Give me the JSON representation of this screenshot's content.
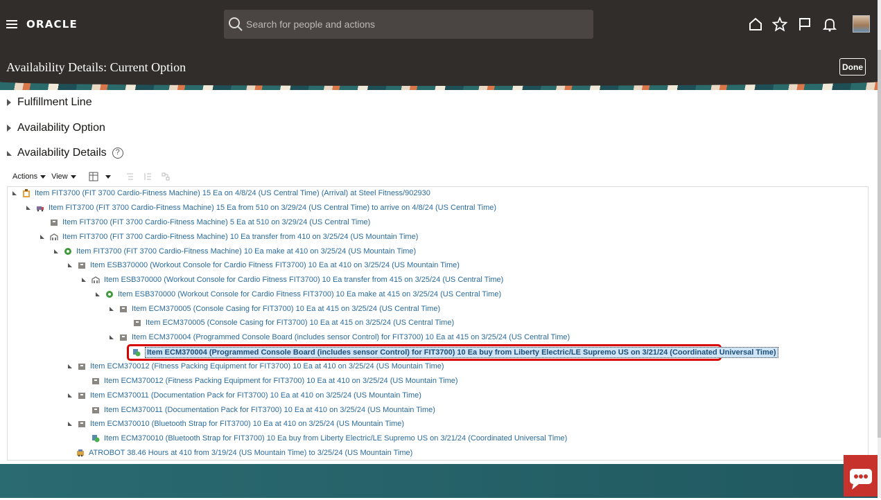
{
  "app": {
    "logo": "ORACLE"
  },
  "search": {
    "placeholder": "Search for people and actions"
  },
  "header": {
    "title": "Availability Details: Current Option",
    "done_label": "Done"
  },
  "sections": {
    "fulfillment": "Fulfillment Line",
    "option": "Availability Option",
    "details": "Availability Details",
    "help_glyph": "?"
  },
  "toolbar": {
    "actions": "Actions",
    "view": "View"
  },
  "tree": [
    {
      "label": "Item FIT3700 (FIT 3700 Cardio-Fitness Machine) 15 Ea on 4/8/24 (US Central Time) (Arrival) at Steel Fitness/902930",
      "icon": "clipboard-icon"
    },
    {
      "label": "Item FIT3700 (FIT 3700 Cardio-Fitness Machine) 15 Ea from 510 on 3/29/24 (US Central Time) to arrive on 4/8/24 (US Central Time)",
      "icon": "shipment-icon"
    },
    {
      "label": "Item FIT3700 (FIT 3700 Cardio-Fitness Machine) 5 Ea at 510 on 3/29/24 (US Central Time)",
      "icon": "inventory-icon"
    },
    {
      "label": "Item FIT3700 (FIT 3700 Cardio-Fitness Machine) 10 Ea transfer from 410 on 3/25/24 (US Mountain Time)",
      "icon": "transfer-icon"
    },
    {
      "label": "Item FIT3700 (FIT 3700 Cardio-Fitness Machine) 10 Ea make at 410 on 3/25/24 (US Mountain Time)",
      "icon": "make-gear-icon"
    },
    {
      "label": "Item ESB370000 (Workout Console for Cardio Fitness FIT3700) 10 Ea at 410 on 3/25/24 (US Mountain Time)",
      "icon": "inventory-icon"
    },
    {
      "label": "Item ESB370000 (Workout Console for Cardio Fitness FIT3700) 10 Ea transfer from 415 on 3/25/24 (US Central Time)",
      "icon": "transfer-icon"
    },
    {
      "label": "Item ESB370000 (Workout Console for Cardio Fitness FIT3700) 10 Ea make at 415 on 3/25/24 (US Central Time)",
      "icon": "make-gear-icon"
    },
    {
      "label": "Item ECM370005 (Console Casing for FIT3700) 10 Ea at 415 on 3/25/24 (US Central Time)",
      "icon": "inventory-icon"
    },
    {
      "label": "Item ECM370005 (Console Casing for FIT3700) 10 Ea at 415 on 3/25/24 (US Central Time)",
      "icon": "inventory-icon"
    },
    {
      "label": "Item ECM370004 (Programmed Console Board (includes sensor Control) for FIT3700) 10 Ea at 415 on 3/25/24 (US Central Time)",
      "icon": "inventory-icon"
    },
    {
      "label": "Item ECM370004 (Programmed Console Board (includes sensor Control) for FIT3700) 10 Ea buy from Liberty Electric/LE Supremo US on 3/21/24 (Coordinated Universal Time)",
      "icon": "buy-icon"
    },
    {
      "label": "Item ECM370012 (Fitness Packing Equipment for FIT3700) 10 Ea at 410 on 3/25/24 (US Mountain Time)",
      "icon": "inventory-icon"
    },
    {
      "label": "Item ECM370012 (Fitness Packing Equipment for FIT3700) 10 Ea at 410 on 3/25/24 (US Mountain Time)",
      "icon": "inventory-icon"
    },
    {
      "label": "Item ECM370011 (Documentation Pack for FIT3700) 10 Ea at 410 on 3/25/24 (US Mountain Time)",
      "icon": "inventory-icon"
    },
    {
      "label": "Item ECM370011 (Documentation Pack for FIT3700) 10 Ea at 410 on 3/25/24 (US Mountain Time)",
      "icon": "inventory-icon"
    },
    {
      "label": "Item ECM370010 (Bluetooth Strap for FIT3700) 10 Ea at 410 on 3/25/24 (US Mountain Time)",
      "icon": "inventory-icon"
    },
    {
      "label": "Item ECM370010 (Bluetooth Strap for FIT3700) 10 Ea buy from Liberty Electric/LE Supremo US on 3/21/24 (Coordinated Universal Time)",
      "icon": "buy-icon"
    },
    {
      "label": "ATROBOT 38.46 Hours at 410 from 3/19/24 (US Mountain Time) to 3/25/24 (US Mountain Time)",
      "icon": "resource-icon"
    }
  ],
  "colors": {
    "header_bg": "#312d2a",
    "link": "#2a6b9c",
    "highlight_border": "#d90000",
    "footer": "#2a6a71"
  }
}
